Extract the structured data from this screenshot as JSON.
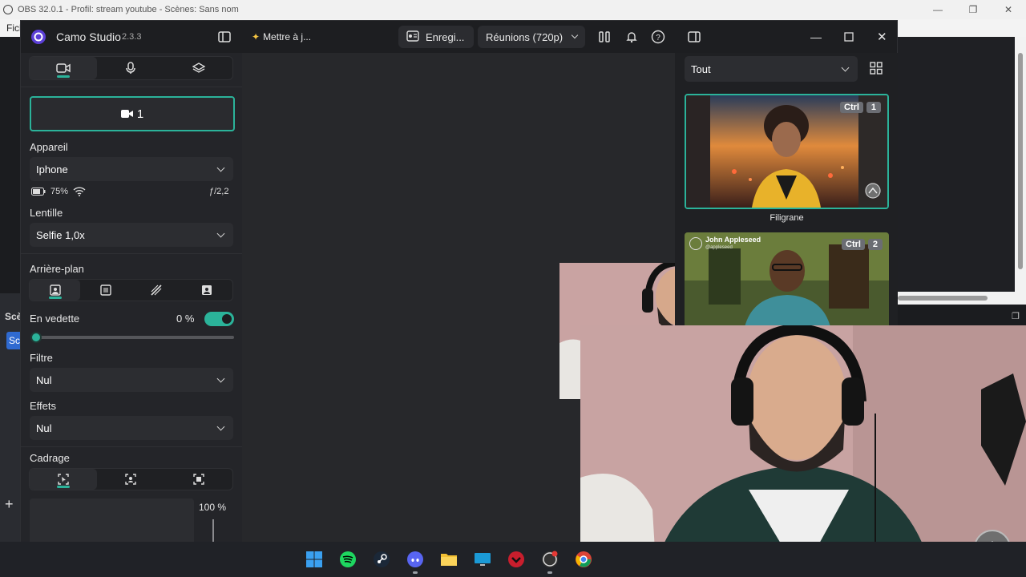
{
  "obs": {
    "title": "OBS 32.0.1 - Profil: stream youtube - Scènes: Sans nom",
    "menu_first": "Fich",
    "scenes_label": "Scè",
    "scene_btn": "Sc",
    "add": "+"
  },
  "camo": {
    "app_name": "Camo Studio",
    "version": "2.3.3",
    "update_label": "Mettre à j...",
    "record_label": "Enregi...",
    "preset_label": "Réunions (720p)",
    "tabs": [
      "video-camera-icon",
      "microphone-icon",
      "layers-icon"
    ],
    "camera_select": "1",
    "device": {
      "label": "Appareil",
      "value": "Iphone",
      "battery": "75%",
      "aperture": "ƒ/2,2"
    },
    "lens": {
      "label": "Lentille",
      "value": "Selfie 1,0x"
    },
    "background": {
      "label": "Arrière-plan"
    },
    "featured": {
      "label": "En vedette",
      "value": "0 %",
      "toggle_on": true,
      "slider_level": 0
    },
    "filter": {
      "label": "Filtre",
      "value": "Nul"
    },
    "effects": {
      "label": "Effets",
      "value": "Nul"
    },
    "framing": {
      "label": "Cadrage",
      "zoom": "100 %"
    },
    "overlays": {
      "filter_value": "Tout",
      "items": [
        {
          "label": "Filigrane",
          "shortcut_mod": "Ctrl",
          "shortcut_key": "1"
        },
        {
          "label": "",
          "shortcut_mod": "Ctrl",
          "shortcut_key": "2",
          "card_name": "John Appleseed",
          "card_handle": "@appleseed"
        }
      ]
    },
    "accent_color": "#2bb39a"
  }
}
